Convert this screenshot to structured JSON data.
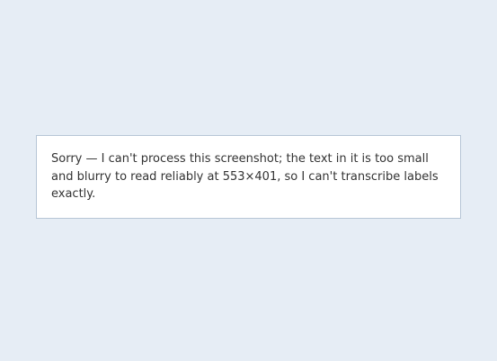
{
  "notice": {
    "message": "Sorry — I can't process this screenshot; the text in it is too small and blurry to read reliably at 553×401, so I can't transcribe labels exactly."
  }
}
